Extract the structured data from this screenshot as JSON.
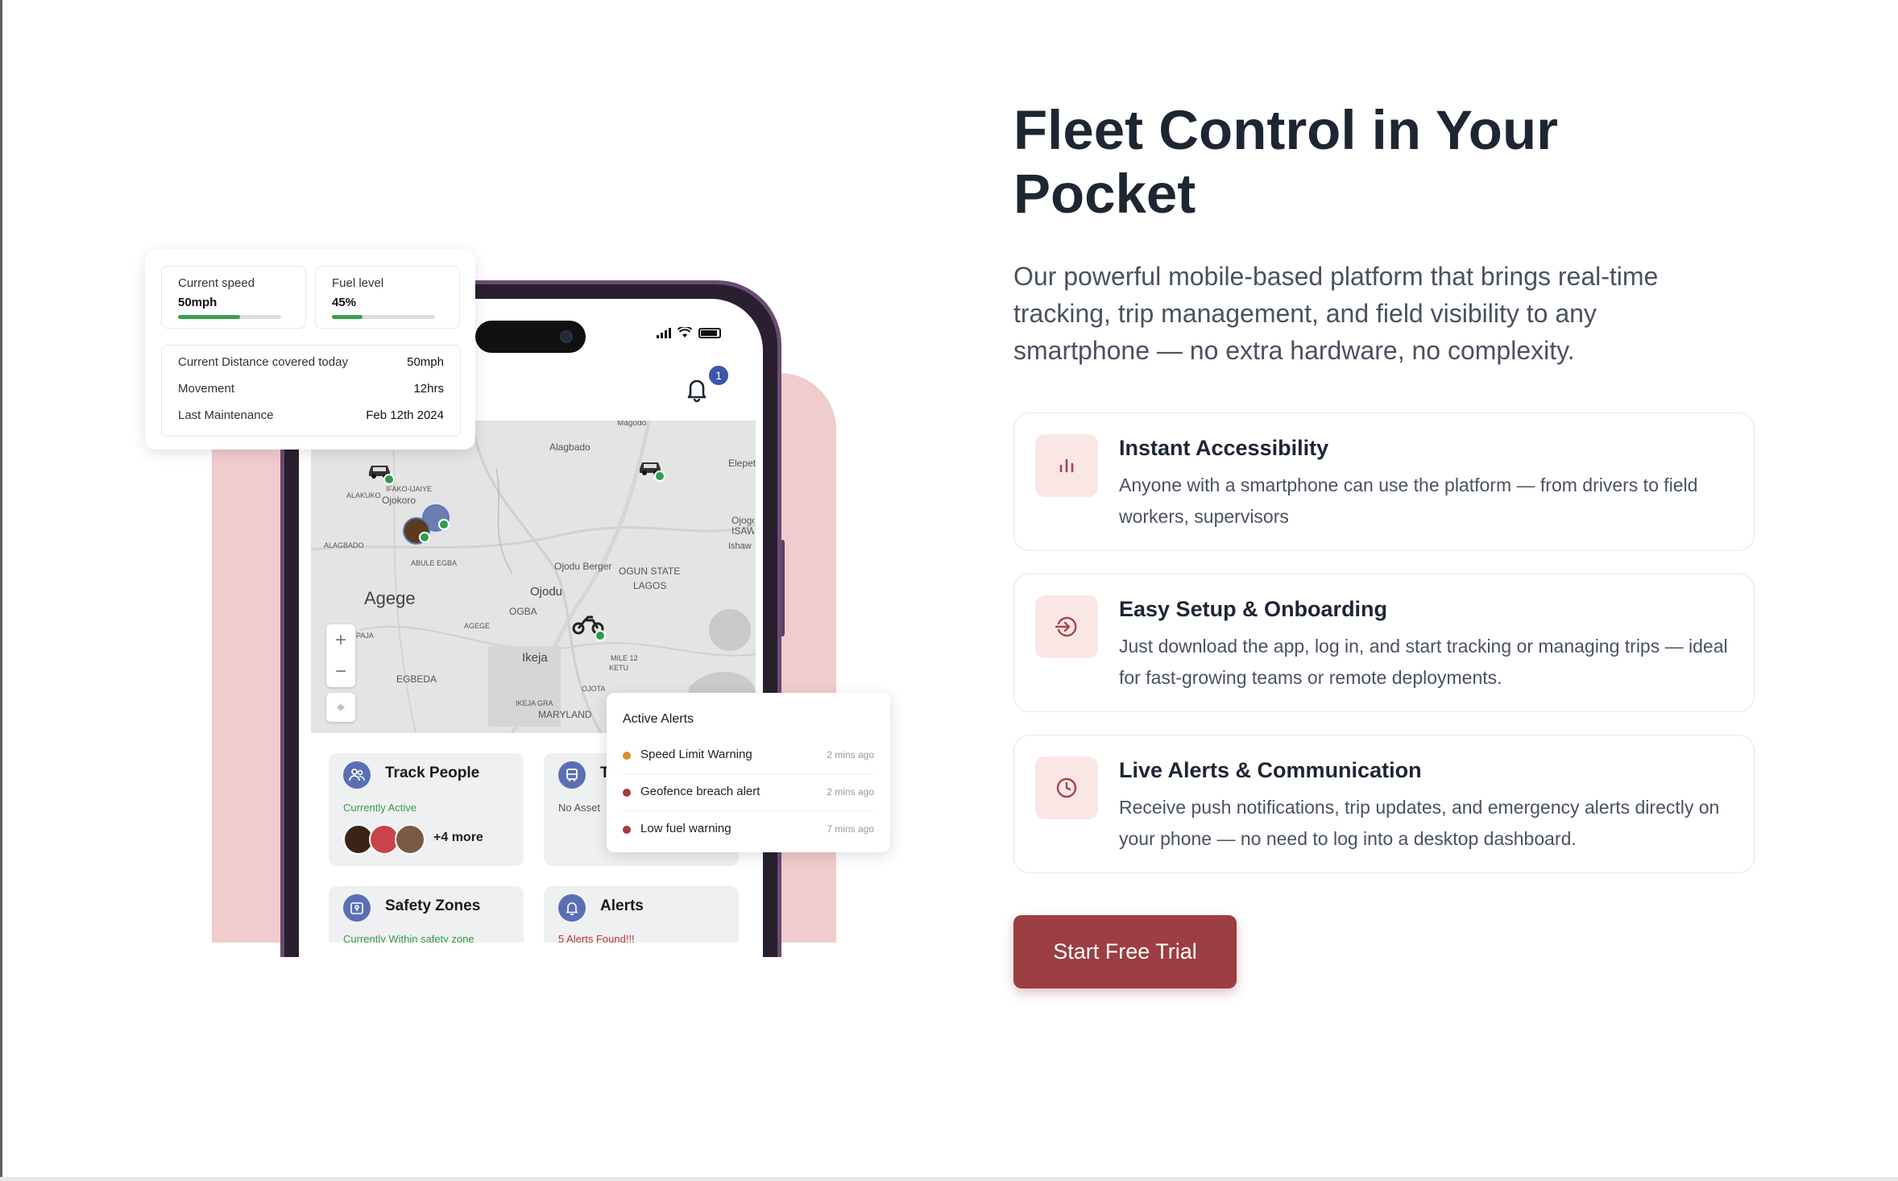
{
  "colors": {
    "accent": "#9c3e42",
    "accent_light": "#fbe6e6",
    "pink_panel": "#f1cccd",
    "heading": "#1e2533",
    "body_text": "#4a5260",
    "active_green": "#3aa04d",
    "alert_orange": "#e08a2a",
    "alert_red": "#a33a3a"
  },
  "hero": {
    "title": "Fleet Control in Your Pocket",
    "lead": "Our powerful mobile-based platform that brings real-time tracking, trip management, and field visibility to any smartphone — no extra hardware, no complexity.",
    "cta_label": "Start Free Trial"
  },
  "features": [
    {
      "icon": "bar-chart-icon",
      "title": "Instant Accessibility",
      "description": "Anyone with a smartphone can use the platform — from drivers to field workers, supervisors"
    },
    {
      "icon": "sign-in-icon",
      "title": "Easy Setup & Onboarding",
      "description": "Just download the app, log in, and start tracking or managing trips — ideal for fast-growing teams or remote deployments."
    },
    {
      "icon": "clock-icon",
      "title": "Live Alerts & Communication",
      "description": "Receive push notifications, trip updates, and emergency alerts directly on your phone — no need to log into a desktop dashboard."
    }
  ],
  "stats_card": {
    "speed": {
      "label": "Current speed",
      "value": "50mph",
      "level": 0.6
    },
    "fuel": {
      "label": "Fuel level",
      "value": "45%",
      "level": 0.3
    },
    "rows": [
      {
        "label": "Current Distance covered today",
        "value": "50mph"
      },
      {
        "label": "Movement",
        "value": "12hrs"
      },
      {
        "label": "Last Maintenance",
        "value": "Feb 12th 2024"
      }
    ]
  },
  "phone": {
    "notification_count": "1",
    "map_labels": [
      "Alagbado",
      "Elepete",
      "IFAKO-IJAIYE",
      "Ojokoro",
      "ALAKUKO",
      "ALAGBADO",
      "ABULE EGBA",
      "Ojogo ISAW",
      "Ishaw",
      "Ojodu Berger",
      "OGUN STATE",
      "LAGOS",
      "Agege",
      "Ojodu",
      "OGBA",
      "AGEGE",
      "Ikeja",
      "EGBEDA",
      "PAJA",
      "MILE 12",
      "KETU",
      "OJOTA",
      "IKEJA GRA",
      "MARYLAND",
      "Magodo"
    ],
    "tiles": {
      "track_people": {
        "title": "Track People",
        "status": "Currently Active",
        "more": "+4 more"
      },
      "track_assets": {
        "title": "T",
        "status": "No Asset"
      },
      "safety_zones": {
        "title": "Safety Zones",
        "status": "Currently Within safety zone"
      },
      "alerts": {
        "title": "Alerts",
        "status": "5 Alerts Found!!!"
      }
    }
  },
  "active_alerts": {
    "title": "Active Alerts",
    "items": [
      {
        "label": "Speed Limit Warning",
        "time": "2 mins ago",
        "color": "#e08a2a"
      },
      {
        "label": "Geofence breach alert",
        "time": "2 mins ago",
        "color": "#a33a3a"
      },
      {
        "label": "Low fuel warning",
        "time": "7 mins ago",
        "color": "#a33a3a"
      }
    ]
  }
}
